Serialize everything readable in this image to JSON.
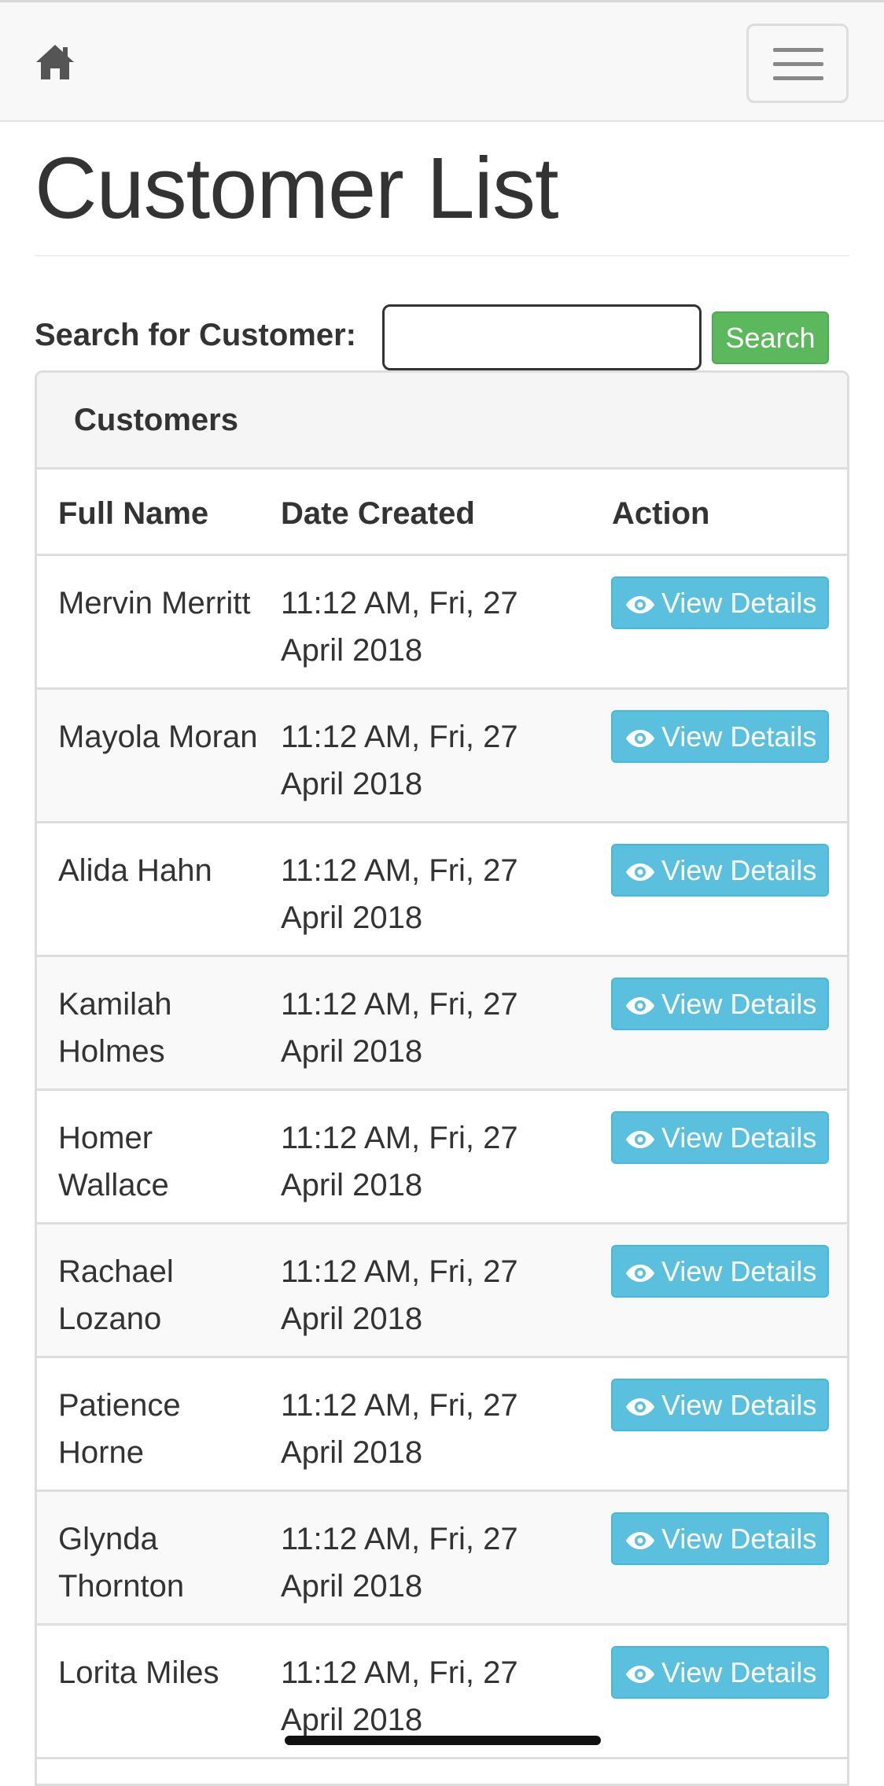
{
  "header": {
    "home_icon": "home-icon",
    "menu_icon": "hamburger-menu-icon"
  },
  "page_title": "Customer List",
  "search": {
    "label": "Search for Customer:",
    "value": "",
    "placeholder": "",
    "button_label": "Search"
  },
  "panel": {
    "heading": "Customers",
    "columns": [
      "Full Name",
      "Date Created",
      "Action"
    ],
    "rows": [
      {
        "name": "Mervin Merritt",
        "date": "11:12 AM, Fri, 27 April 2018",
        "action": "View Details"
      },
      {
        "name": "Mayola Moran",
        "date": "11:12 AM, Fri, 27 April 2018",
        "action": "View Details"
      },
      {
        "name": "Alida Hahn",
        "date": "11:12 AM, Fri, 27 April 2018",
        "action": "View Details"
      },
      {
        "name": "Kamilah Holmes",
        "date": "11:12 AM, Fri, 27 April 2018",
        "action": "View Details"
      },
      {
        "name": "Homer Wallace",
        "date": "11:12 AM, Fri, 27 April 2018",
        "action": "View Details"
      },
      {
        "name": "Rachael Lozano",
        "date": "11:12 AM, Fri, 27 April 2018",
        "action": "View Details"
      },
      {
        "name": "Patience Horne",
        "date": "11:12 AM, Fri, 27 April 2018",
        "action": "View Details"
      },
      {
        "name": "Glynda Thornton",
        "date": "11:12 AM, Fri, 27 April 2018",
        "action": "View Details"
      },
      {
        "name": "Lorita Miles",
        "date": "11:12 AM, Fri, 27 April 2018",
        "action": "View Details"
      }
    ]
  },
  "colors": {
    "search_button": "#5cb85c",
    "view_button": "#5bc0de",
    "text": "#333333"
  }
}
